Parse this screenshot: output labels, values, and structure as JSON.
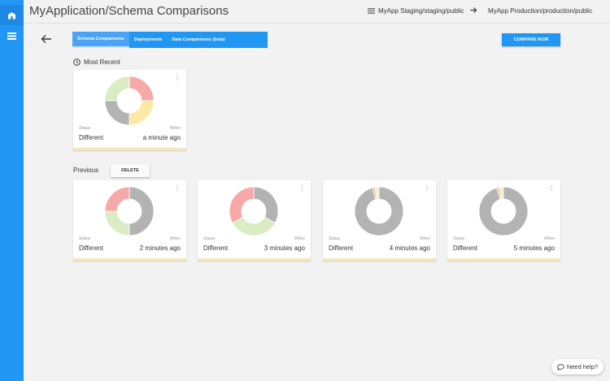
{
  "header": {
    "title": "MyApplication/Schema Comparisons",
    "source": "MyApp Staging/staging/public",
    "target": "MyApp Production/production/public"
  },
  "tabs": [
    {
      "label": "Schema Comparisons",
      "active": true
    },
    {
      "label": "Deployments",
      "active": false
    },
    {
      "label": "Data Comparisons (beta)",
      "active": false
    }
  ],
  "actions": {
    "compare_label": "COMPARE NOW",
    "delete_label": "DELETE"
  },
  "sections": {
    "recent_label": "Most Recent",
    "previous_label": "Previous"
  },
  "colors": {
    "accent": "#2196f3",
    "red": "#f7a9a8",
    "yellow": "#fde9a6",
    "green": "#d9ecc4",
    "grey": "#b3b3b3"
  },
  "recent_card": {
    "status_label": "Status",
    "when_label": "When",
    "status": "Different",
    "when": "a minute ago",
    "slices": [
      {
        "name": "red",
        "fraction": 0.25
      },
      {
        "name": "yellow",
        "fraction": 0.25
      },
      {
        "name": "grey",
        "fraction": 0.25
      },
      {
        "name": "green",
        "fraction": 0.25
      }
    ]
  },
  "previous_cards": [
    {
      "status_label": "Status",
      "when_label": "When",
      "status": "Different",
      "when": "2 minutes ago",
      "slices": [
        {
          "name": "grey",
          "fraction": 0.5
        },
        {
          "name": "green",
          "fraction": 0.25
        },
        {
          "name": "red",
          "fraction": 0.25
        }
      ]
    },
    {
      "status_label": "Status",
      "when_label": "When",
      "status": "Different",
      "when": "3 minutes ago",
      "slices": [
        {
          "name": "grey",
          "fraction": 0.33
        },
        {
          "name": "green",
          "fraction": 0.34
        },
        {
          "name": "red",
          "fraction": 0.33
        }
      ]
    },
    {
      "status_label": "Status",
      "when_label": "When",
      "status": "Different",
      "when": "4 minutes ago",
      "slices": [
        {
          "name": "grey",
          "fraction": 0.955
        },
        {
          "name": "red",
          "fraction": 0.015
        },
        {
          "name": "yellow",
          "fraction": 0.015
        },
        {
          "name": "green",
          "fraction": 0.015
        }
      ]
    },
    {
      "status_label": "Status",
      "when_label": "When",
      "status": "Different",
      "when": "5 minutes ago",
      "slices": [
        {
          "name": "grey",
          "fraction": 0.955
        },
        {
          "name": "red",
          "fraction": 0.015
        },
        {
          "name": "yellow",
          "fraction": 0.015
        },
        {
          "name": "green",
          "fraction": 0.015
        }
      ]
    }
  ],
  "help": {
    "label": "Need help?",
    "icon": "chat-bubble-icon"
  }
}
